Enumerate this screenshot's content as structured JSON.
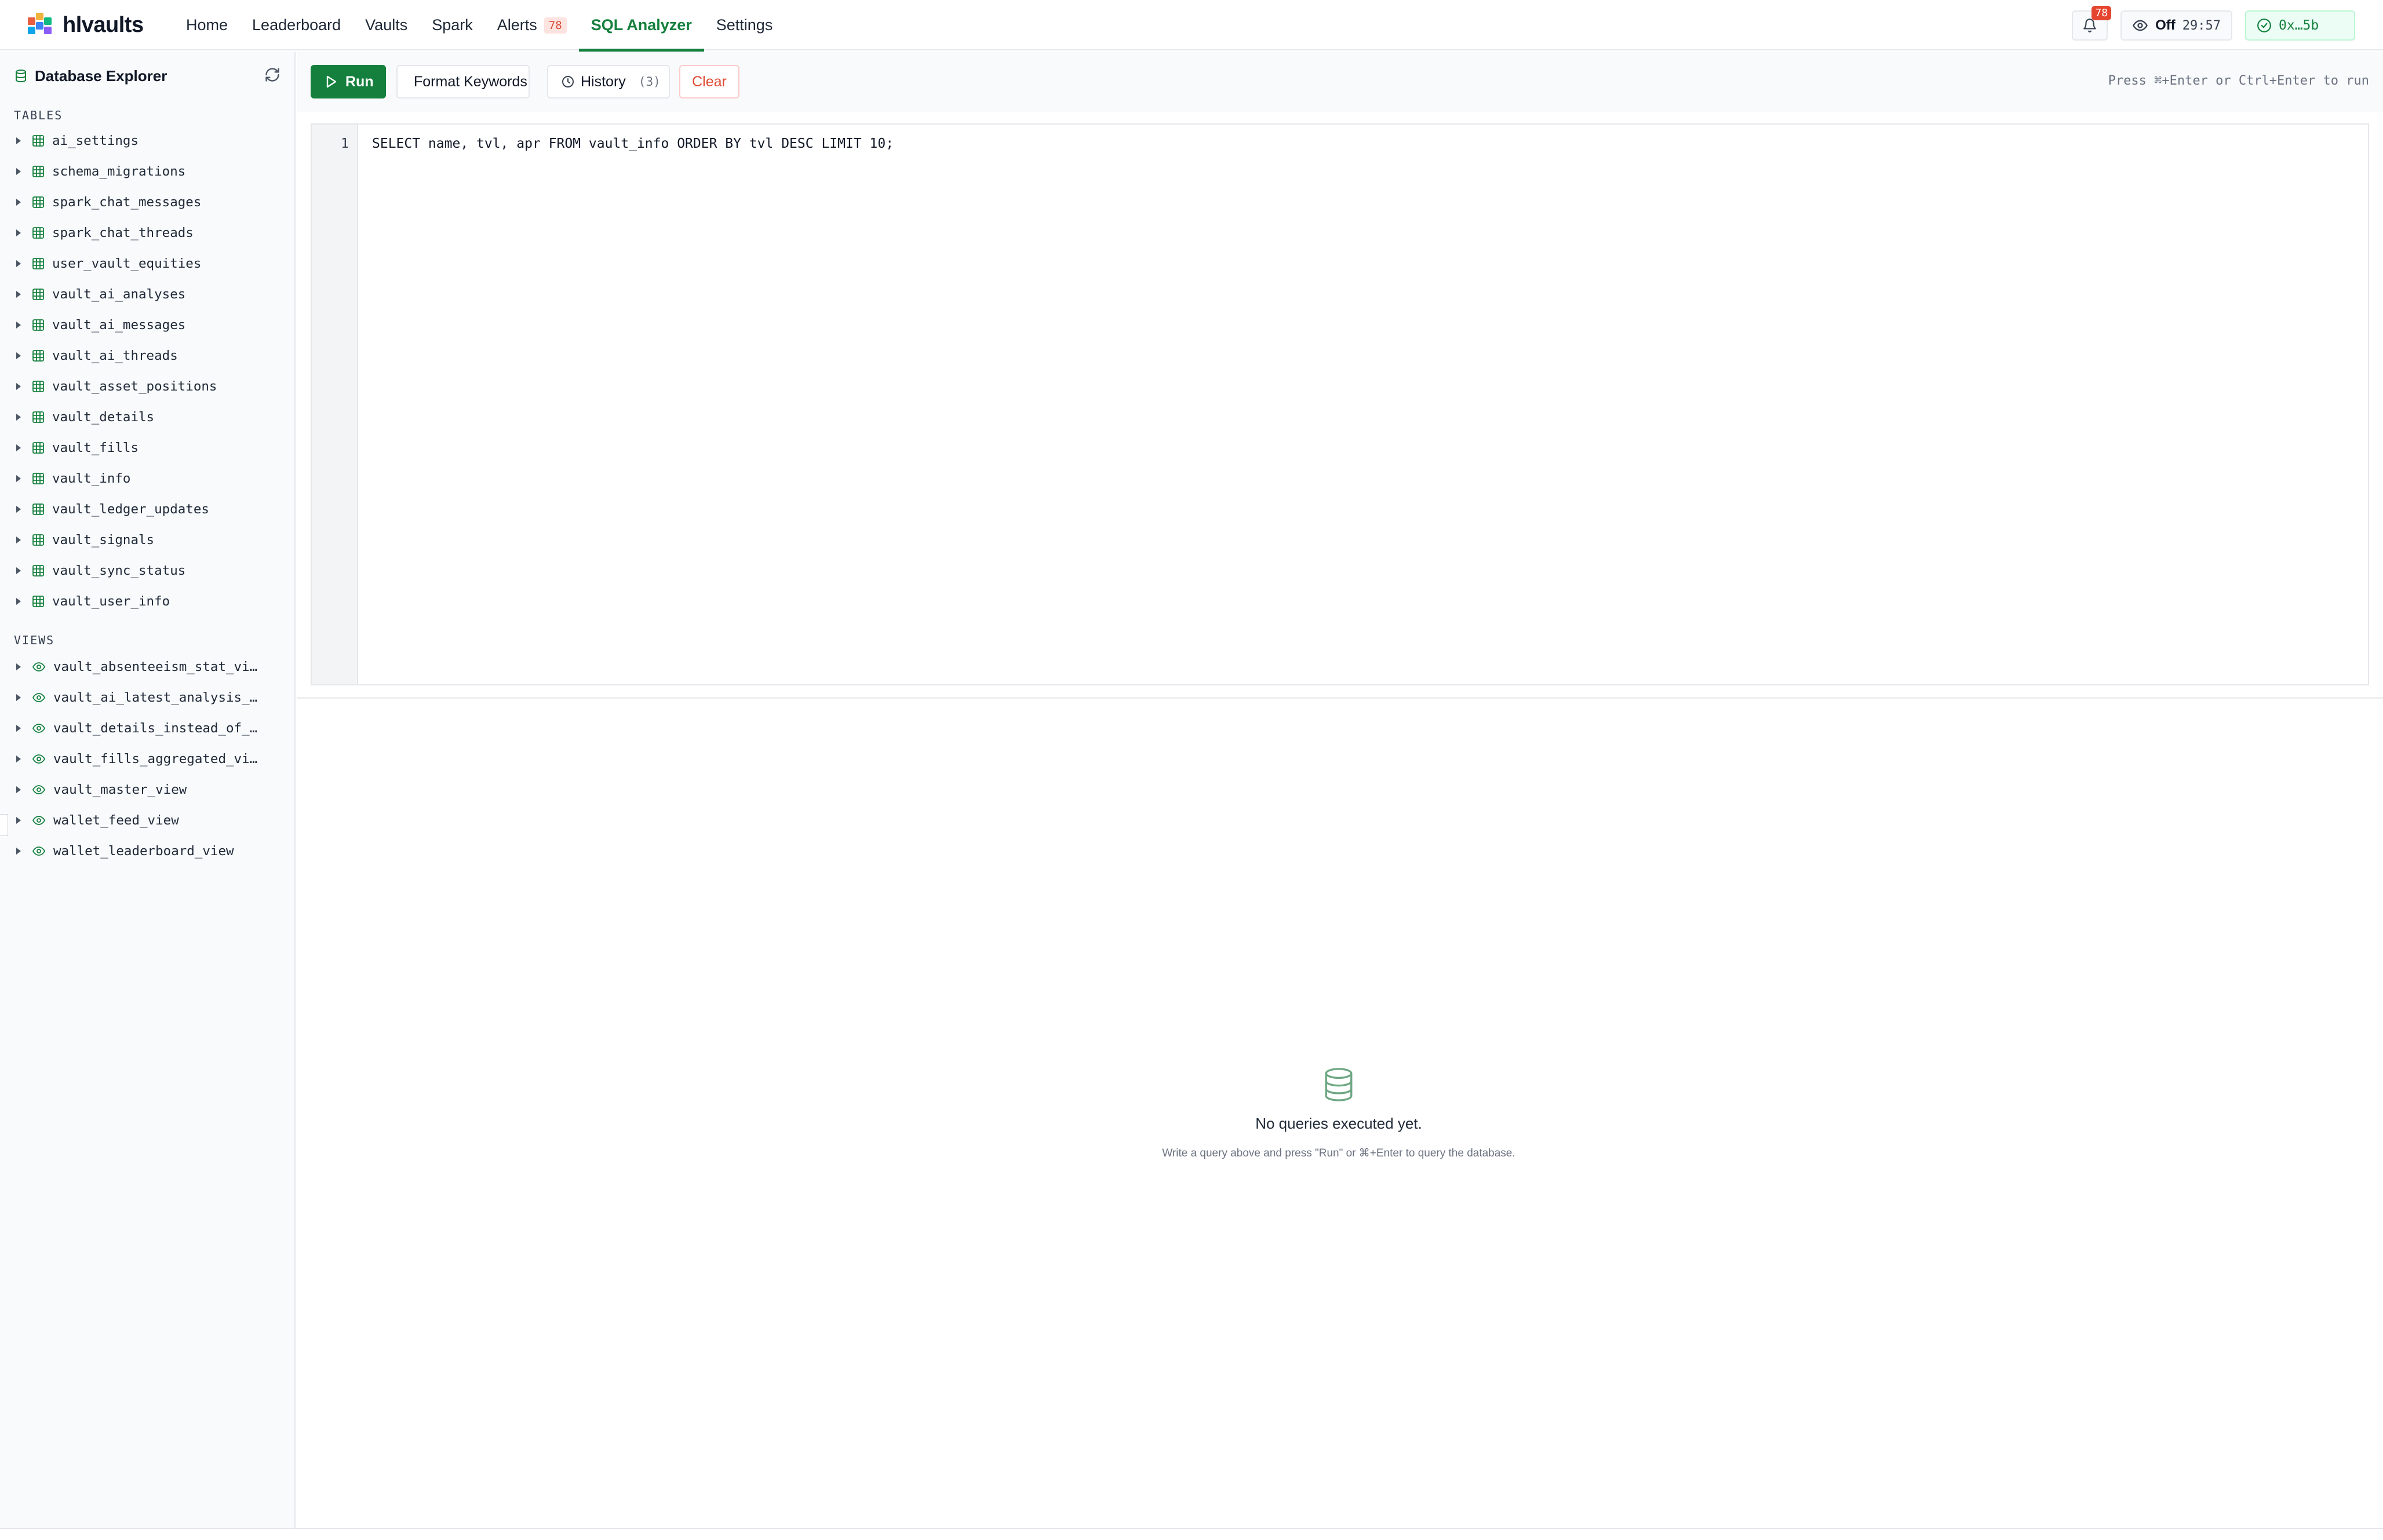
{
  "app": {
    "logo_text": "hlvaults"
  },
  "nav": {
    "items": [
      {
        "label": "Home",
        "active": false
      },
      {
        "label": "Leaderboard",
        "active": false
      },
      {
        "label": "Vaults",
        "active": false
      },
      {
        "label": "Spark",
        "active": false
      },
      {
        "label": "Alerts",
        "active": false,
        "badge": "78"
      },
      {
        "label": "SQL Analyzer",
        "active": true
      },
      {
        "label": "Settings",
        "active": false
      }
    ]
  },
  "top_right": {
    "notification_count": "78",
    "watch_label": "Off",
    "watch_timer": "29:57",
    "wallet_label": "0x…5b",
    "icons": {
      "bell": "bell-icon",
      "watch": "eye-icon",
      "wallet": "check-circle-icon"
    }
  },
  "sidebar": {
    "title": "Database Explorer",
    "tables_header": "TABLES",
    "views_header": "VIEWS",
    "tables": [
      "ai_settings",
      "schema_migrations",
      "spark_chat_messages",
      "spark_chat_threads",
      "user_vault_equities",
      "vault_ai_analyses",
      "vault_ai_messages",
      "vault_ai_threads",
      "vault_asset_positions",
      "vault_details",
      "vault_fills",
      "vault_info",
      "vault_ledger_updates",
      "vault_signals",
      "vault_sync_status",
      "vault_user_info"
    ],
    "views": [
      "vault_absenteeism_stat_vi…",
      "vault_ai_latest_analysis_…",
      "vault_details_instead_of_…",
      "vault_fills_aggregated_vi…",
      "vault_master_view",
      "wallet_feed_view",
      "wallet_leaderboard_view"
    ]
  },
  "toolbar": {
    "run_label": "Run",
    "format_label": "Format Keywords",
    "history_label": "History",
    "history_count": "(3)",
    "clear_label": "Clear",
    "shortcut_hint": "Press ⌘+Enter or Ctrl+Enter to run"
  },
  "editor": {
    "line_number": "1",
    "query": "SELECT name, tvl, apr FROM vault_info ORDER BY tvl DESC LIMIT 10;"
  },
  "results": {
    "empty_title": "No queries executed yet.",
    "empty_subtitle": "Write a query above and press \"Run\" or ⌘+Enter to query the database."
  },
  "colors": {
    "brand_green": "#15803d",
    "alert_red": "#e5452f",
    "clear_red": "#e04b32"
  }
}
